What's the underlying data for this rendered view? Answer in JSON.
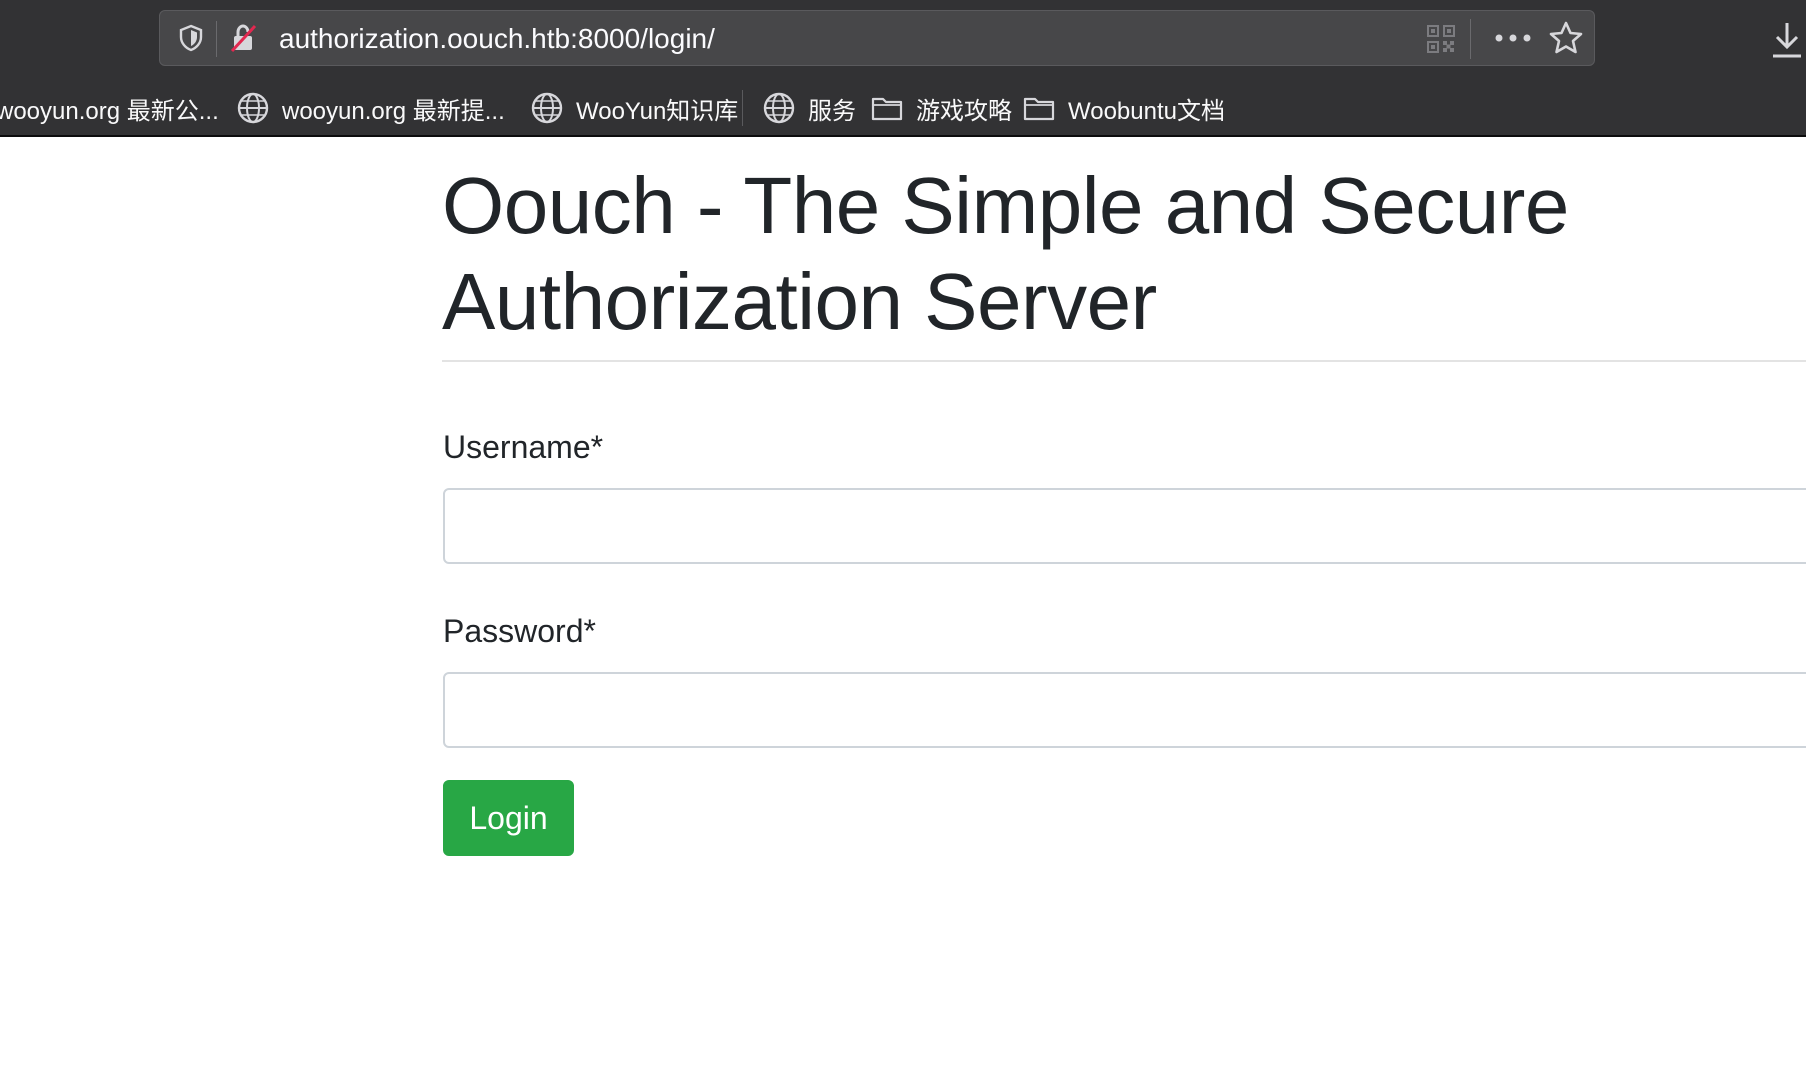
{
  "browser": {
    "url": "authorization.oouch.htb:8000/login/",
    "bookmarks": [
      {
        "label": "wooyun.org 最新公...",
        "icon": "globe-icon"
      },
      {
        "label": "wooyun.org 最新提...",
        "icon": "globe-icon"
      },
      {
        "label": "WooYun知识库",
        "icon": "globe-icon"
      },
      {
        "label": "服务",
        "icon": "globe-icon"
      },
      {
        "label": "游戏攻略",
        "icon": "folder-icon"
      },
      {
        "label": "Woobuntu文档",
        "icon": "folder-icon"
      }
    ]
  },
  "page": {
    "title": "Oouch - The Simple and Secure Authorization Server",
    "form": {
      "username_label": "Username*",
      "username_value": "",
      "password_label": "Password*",
      "password_value": "",
      "login_label": "Login"
    }
  },
  "colors": {
    "chrome_bg": "#323234",
    "urlbar_bg": "#474749",
    "login_button": "#28a745",
    "text": "#212529"
  }
}
